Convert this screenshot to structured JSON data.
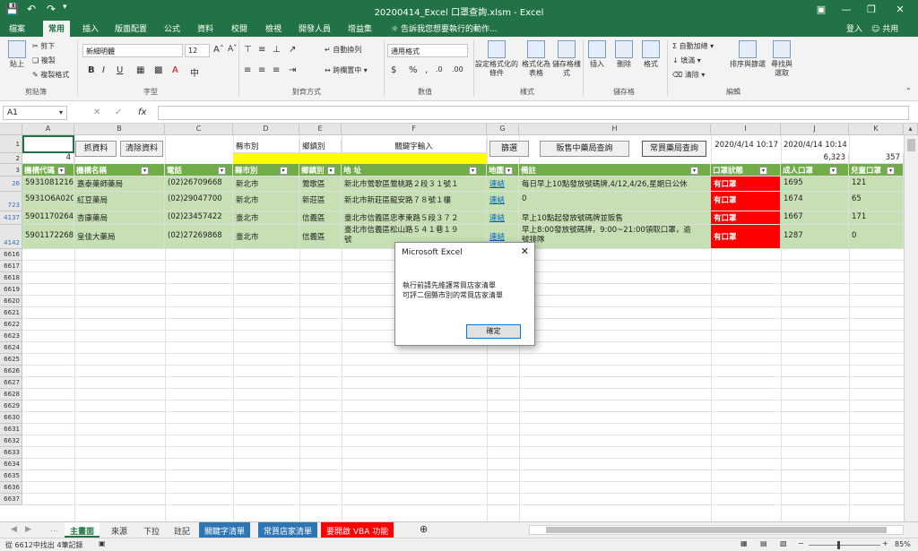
{
  "title": "20200414_Excel 口罩查詢.xlsm - Excel",
  "user": "登入",
  "share": "共用",
  "tell_me": "告訴我您想要執行的動作...",
  "tabs": [
    "檔案",
    "常用",
    "插入",
    "版面配置",
    "公式",
    "資料",
    "校閱",
    "檢視",
    "開發人員",
    "增益集"
  ],
  "ribbon": {
    "clipboard": {
      "paste": "貼上",
      "cut": "剪下",
      "copy": "複製",
      "painter": "複製格式",
      "label": "剪貼簿"
    },
    "font": {
      "name": "新細明體",
      "size": "12",
      "label": "字型"
    },
    "align": {
      "wrap": "自動換列",
      "merge": "跨欄置中",
      "label": "對齊方式"
    },
    "number": {
      "format": "通用格式",
      "label": "數值"
    },
    "styles": {
      "cond": "設定格式化的條件",
      "table": "格式化為表格",
      "cell": "儲存格樣式",
      "label": "樣式"
    },
    "cells": {
      "insert": "插入",
      "delete": "刪除",
      "format": "格式",
      "label": "儲存格"
    },
    "editing": {
      "autosum": "自動加總",
      "fill": "填滿",
      "clear": "清除",
      "sort": "排序與篩選",
      "find": "尋找與選取",
      "label": "編輯"
    }
  },
  "namebox": "A1",
  "columns": [
    "A",
    "B",
    "C",
    "D",
    "E",
    "F",
    "G",
    "H",
    "I",
    "J",
    "K"
  ],
  "controls": {
    "capture": "抓資料",
    "clear": "清除資料",
    "county_label": "縣市別",
    "town_label": "鄉鎮別",
    "keyword_label": "關鍵字輸入",
    "filter": "篩選",
    "sale_query": "販售中藥局查詢",
    "regular_query": "常買藥局查詢",
    "date1": "2020/4/14 10:17",
    "date2": "2020/4/14 10:14",
    "total_adult": "6,323",
    "total_child": "357",
    "row2_a": "4"
  },
  "headers": [
    "機構代碼",
    "機構名稱",
    "電話",
    "縣市別",
    "鄉鎮別",
    "地 址",
    "地圖",
    "備註",
    "口罩狀態",
    "成人口罩",
    "兒童口罩"
  ],
  "rows": [
    {
      "rn": "26",
      "code": "5931081216",
      "name": "嘉泰藥師藥局",
      "tel": "(02)26709668",
      "county": "新北市",
      "town": "鶯歌區",
      "addr": "新北市鶯歌區鶯桃路２段３１號１",
      "map": "連結",
      "note": "每日早上10點發放號碼牌,4/12,4/26,星期日公休",
      "status": "有口罩",
      "adult": "1695",
      "child": "121"
    },
    {
      "rn": "723",
      "code": "5931O6A020",
      "name": "紅豆藥局",
      "tel": "(02)29047700",
      "county": "新北市",
      "town": "新莊區",
      "addr": "新北市新莊區龍安路７８號１樓",
      "map": "連結",
      "note": "0",
      "status": "有口罩",
      "adult": "1674",
      "child": "65"
    },
    {
      "rn": "4137",
      "code": "5901170264",
      "name": "杏康藥局",
      "tel": "(02)23457422",
      "county": "臺北市",
      "town": "信義區",
      "addr": "臺北市信義區忠孝東路５段３７２",
      "map": "連結",
      "note": "早上10點起發放號碼牌並販售",
      "status": "有口罩",
      "adult": "1667",
      "child": "171"
    },
    {
      "rn": "4142",
      "code": "5901172268",
      "name": "皇佳大藥局",
      "tel": "(02)27269868",
      "county": "臺北市",
      "town": "信義區",
      "addr": "臺北市信義區松山路５４１巷１９",
      "addr2": "號",
      "map": "連結",
      "note": "早上8:00發放號碼牌，9:00~21:00領取口罩，逾",
      "note2": "號排隊",
      "status": "有口罩",
      "adult": "1287",
      "child": "0"
    }
  ],
  "empty_rows": [
    "6616",
    "6617",
    "6618",
    "6619",
    "6620",
    "6621",
    "6622",
    "6623",
    "6624",
    "6625",
    "6626",
    "6627",
    "6628",
    "6629",
    "6630",
    "6631",
    "6632",
    "6633",
    "6634",
    "6635",
    "6636",
    "6637"
  ],
  "dialog": {
    "title": "Microsoft Excel",
    "line1": "執行前請先維護常買店家清單",
    "line2": "可評二個縣市別的常買店家清單",
    "ok": "確定"
  },
  "sheet_tabs": [
    "主畫面",
    "來源",
    "下拉",
    "註記",
    "關鍵字清單",
    "常買店家清單",
    "要開啟 VBA 功能"
  ],
  "status": {
    "text": "從 6612中找出 4筆記錄",
    "zoom": "85%"
  },
  "colors": {
    "accent": "#217346",
    "header_green": "#70ad47",
    "row_green": "#c6e0b4",
    "alert_red": "#ff0000",
    "tab_blue": "#2e75b6",
    "tab_red": "#ff0000"
  }
}
